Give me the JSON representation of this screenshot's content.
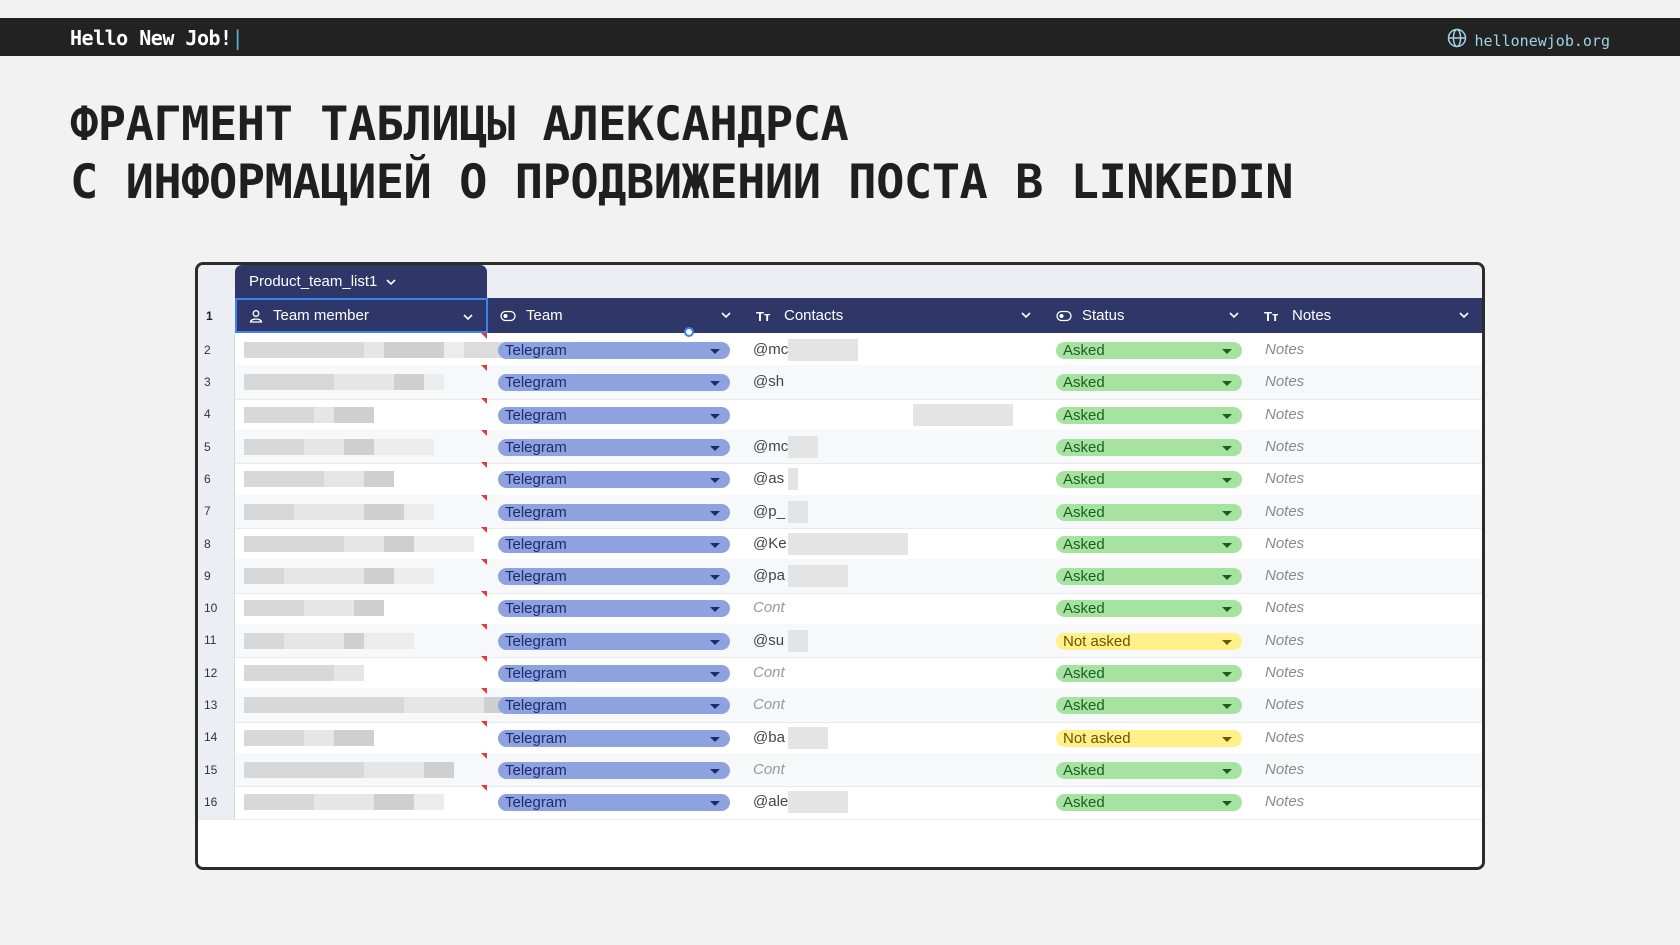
{
  "brand": {
    "name": "Hello New Job!",
    "cursor": "|",
    "site": "hellonewjob.org",
    "site_icon": "globe-icon"
  },
  "headline": {
    "line1": "ФРАГМЕНТ ТАБЛИЦЫ АЛЕКСАНДРСА",
    "line2": "С ИНФОРМАЦИЕЙ О ПРОДВИЖЕНИИ ПОСТА В LINKEDIN"
  },
  "sheet": {
    "tab_label": "Product_team_list1",
    "header_row_number": "1",
    "columns": [
      {
        "label": "Team member",
        "icon": "person-icon"
      },
      {
        "label": "Team",
        "icon": "select-icon"
      },
      {
        "label": "Contacts",
        "icon": "text-icon"
      },
      {
        "label": "Status",
        "icon": "select-icon"
      },
      {
        "label": "Notes",
        "icon": "text-icon"
      }
    ],
    "rows": [
      {
        "n": "2",
        "team": "Telegram",
        "contact": "@mc",
        "status": "Asked",
        "notes": "Notes"
      },
      {
        "n": "3",
        "team": "Telegram",
        "contact": "@sh",
        "status": "Asked",
        "notes": "Notes"
      },
      {
        "n": "4",
        "team": "Telegram",
        "contact": "",
        "status": "Asked",
        "notes": "Notes"
      },
      {
        "n": "5",
        "team": "Telegram",
        "contact": "@mc",
        "status": "Asked",
        "notes": "Notes"
      },
      {
        "n": "6",
        "team": "Telegram",
        "contact": "@as",
        "status": "Asked",
        "notes": "Notes"
      },
      {
        "n": "7",
        "team": "Telegram",
        "contact": "@p_",
        "status": "Asked",
        "notes": "Notes"
      },
      {
        "n": "8",
        "team": "Telegram",
        "contact": "@Ke",
        "status": "Asked",
        "notes": "Notes"
      },
      {
        "n": "9",
        "team": "Telegram",
        "contact": "@pa",
        "status": "Asked",
        "notes": "Notes"
      },
      {
        "n": "10",
        "team": "Telegram",
        "contact": "Cont",
        "status": "Asked",
        "notes": "Notes"
      },
      {
        "n": "11",
        "team": "Telegram",
        "contact": "@su",
        "status": "Not asked",
        "notes": "Notes"
      },
      {
        "n": "12",
        "team": "Telegram",
        "contact": "Cont",
        "status": "Asked",
        "notes": "Notes"
      },
      {
        "n": "13",
        "team": "Telegram",
        "contact": "Cont",
        "status": "Asked",
        "notes": "Notes"
      },
      {
        "n": "14",
        "team": "Telegram",
        "contact": "@ba",
        "status": "Not asked",
        "notes": "Notes"
      },
      {
        "n": "15",
        "team": "Telegram",
        "contact": "Cont",
        "status": "Asked",
        "notes": "Notes"
      },
      {
        "n": "16",
        "team": "Telegram",
        "contact": "@ale",
        "status": "Asked",
        "notes": "Notes"
      }
    ]
  },
  "colors": {
    "header_bg": "#2f3768",
    "team_pill": "#8fa2e0",
    "asked": "#a6e3a1",
    "not_asked": "#fff08a",
    "topbar": "#222222"
  }
}
